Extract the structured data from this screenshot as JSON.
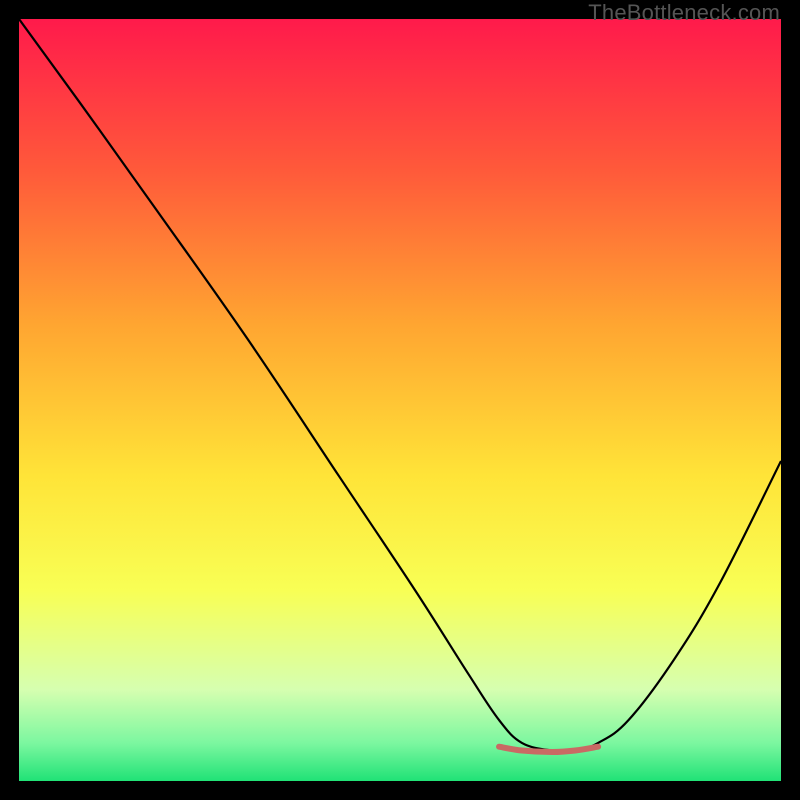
{
  "watermark": "TheBottleneck.com",
  "chart_data": {
    "type": "line",
    "title": "",
    "xlabel": "",
    "ylabel": "",
    "xlim": [
      0,
      100
    ],
    "ylim": [
      0,
      100
    ],
    "grid": false,
    "legend": false,
    "background_gradient": {
      "stops": [
        {
          "offset": 0.0,
          "color": "#ff1a4b"
        },
        {
          "offset": 0.2,
          "color": "#ff5a3a"
        },
        {
          "offset": 0.4,
          "color": "#ffa531"
        },
        {
          "offset": 0.6,
          "color": "#ffe438"
        },
        {
          "offset": 0.75,
          "color": "#f8ff55"
        },
        {
          "offset": 0.88,
          "color": "#d6ffb0"
        },
        {
          "offset": 0.95,
          "color": "#7cf7a0"
        },
        {
          "offset": 1.0,
          "color": "#20e276"
        }
      ]
    },
    "series": [
      {
        "name": "bottleneck-curve",
        "stroke": "#000000",
        "stroke_width": 2.2,
        "x": [
          0,
          8,
          18,
          30,
          42,
          52,
          59,
          63,
          66,
          70,
          73,
          76,
          80,
          86,
          92,
          100
        ],
        "values": [
          100,
          89,
          75,
          58,
          40,
          25,
          14,
          8,
          5,
          4,
          4,
          5,
          8,
          16,
          26,
          42
        ]
      },
      {
        "name": "optimal-range",
        "stroke": "#c96a64",
        "stroke_width": 6,
        "x": [
          63,
          66,
          70,
          73,
          76
        ],
        "values": [
          4.5,
          4.0,
          3.8,
          4.0,
          4.5
        ]
      }
    ]
  }
}
